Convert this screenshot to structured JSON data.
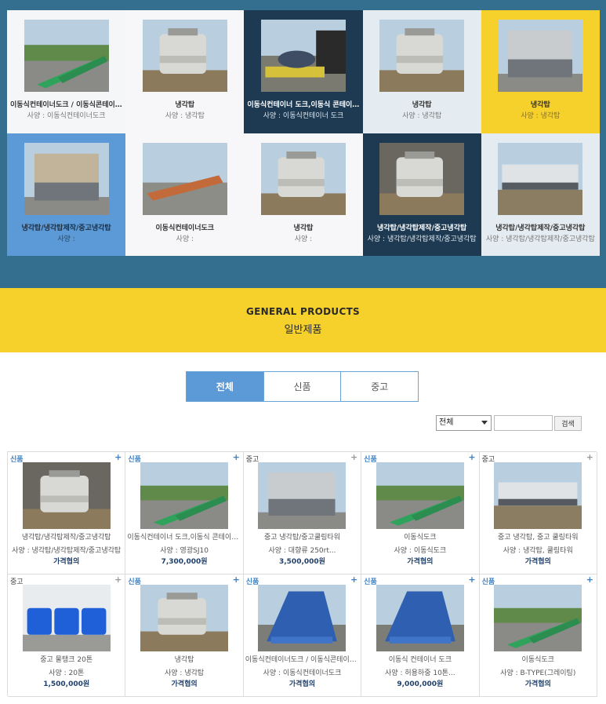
{
  "featured": [
    {
      "title": "이동식컨테이너도크 / 이동식콘테이너도크",
      "spec": "사양 : 이동식컨테이너도크",
      "theme": "white",
      "image": "green-ramp"
    },
    {
      "title": "냉각탑",
      "spec": "사양 : 냉각탑",
      "theme": "light",
      "image": "round-tower"
    },
    {
      "title": "이동식컨테이너 도크,이동식 콘테이너도크",
      "spec": "사양 : 이동식컨테이너 도크",
      "theme": "dark",
      "image": "car-ramp"
    },
    {
      "title": "냉각탑",
      "spec": "사양 : 냉각탑",
      "theme": "pale",
      "image": "round-tower-grey"
    },
    {
      "title": "냉각탑",
      "spec": "사양 : 냉각탑",
      "theme": "yellow",
      "image": "box-tower"
    },
    {
      "title": "냉각탑/냉각탑제작/중고냉각탑",
      "spec": "사양 :",
      "theme": "blue",
      "image": "square-tower"
    },
    {
      "title": "이동식컨테이너도크",
      "spec": "사양 :",
      "theme": "light",
      "image": "orange-ramp"
    },
    {
      "title": "냉각탑",
      "spec": "사양 :",
      "theme": "light",
      "image": "white-towers"
    },
    {
      "title": "냉각탑/냉각탑제작/중고냉각탑",
      "spec": "사양 : 냉각탑/냉각탑제작/중고냉각탑",
      "theme": "dark",
      "image": "white-towers-indoor"
    },
    {
      "title": "냉각탑/냉각탑제작/중고냉각탑",
      "spec": "사양 : 냉각탑/냉각탑제작/중고냉각탑",
      "theme": "pale",
      "image": "long-tower"
    }
  ],
  "section": {
    "title_en": "GENERAL PRODUCTS",
    "title_ko": "일반제품"
  },
  "tabs": [
    {
      "label": "전체",
      "active": true
    },
    {
      "label": "신품",
      "active": false
    },
    {
      "label": "중고",
      "active": false
    }
  ],
  "search": {
    "selected": "전체",
    "input_value": "",
    "button_label": "검색"
  },
  "products": [
    {
      "badge": "신품",
      "type": "new",
      "title": "냉각탑/냉각탑제작/중고냉각탑",
      "spec": "사양 : 냉각탑/냉각탑제작/중고냉각탑",
      "price": "가격협의",
      "image": "white-towers-indoor"
    },
    {
      "badge": "신품",
      "type": "new",
      "title": "이동식컨테이너 도크,이동식 콘테이너도크",
      "spec": "사양 : 영광SJ10",
      "price": "7,300,000원",
      "image": "green-ramps"
    },
    {
      "badge": "중고",
      "type": "used",
      "title": "중고 냉각탑/중고쿨링타워",
      "spec": "사양 : 대향류 250rt...",
      "price": "3,500,000원",
      "image": "box-tower-grey"
    },
    {
      "badge": "신품",
      "type": "new",
      "title": "이동식도크",
      "spec": "사양 : 이동식도크",
      "price": "가격협의",
      "image": "green-ramp-single"
    },
    {
      "badge": "중고",
      "type": "used",
      "title": "중고 냉각탑, 중고 쿨링타워",
      "spec": "사양 : 냉각탑, 쿨링타워",
      "price": "가격협의",
      "image": "long-tower"
    },
    {
      "badge": "중고",
      "type": "used",
      "title": "중고 물탱크 20톤",
      "spec": "사양 : 20톤",
      "price": "1,500,000원",
      "image": "blue-tanks"
    },
    {
      "badge": "신품",
      "type": "new",
      "title": "냉각탑",
      "spec": "사양 : 냉각탑",
      "price": "가격협의",
      "image": "round-tower"
    },
    {
      "badge": "신품",
      "type": "new",
      "title": "이동식컨테이너도크 / 이동식콘테이너도크",
      "spec": "사양 : 이동식컨테이너도크",
      "price": "가격협의",
      "image": "blue-ramp"
    },
    {
      "badge": "신품",
      "type": "new",
      "title": "이동식 컨테이너 도크",
      "spec": "사양 : 허용하중 10톤...",
      "price": "9,000,000원",
      "image": "blue-ramp-wide"
    },
    {
      "badge": "신품",
      "type": "new",
      "title": "이동식도크",
      "spec": "사양 : B-TYPE(그레이팅)",
      "price": "가격협의",
      "image": "green-ramp-stack"
    }
  ]
}
